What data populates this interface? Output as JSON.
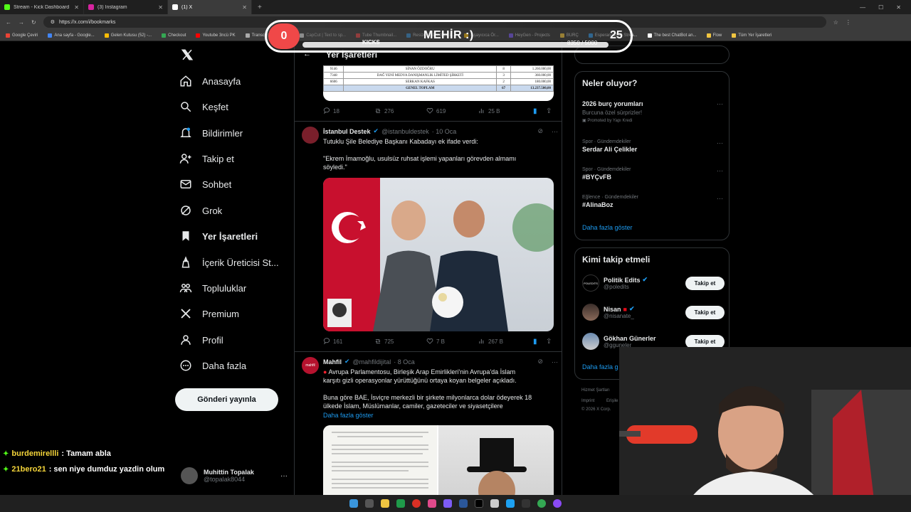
{
  "browser": {
    "tabs": [
      {
        "title": "Stream - Kick Dashboard",
        "color": "#53fc18",
        "active": false
      },
      {
        "title": "(3) Instagram",
        "color": "#d6249f",
        "active": false
      },
      {
        "title": "(1) X",
        "color": "#ffffff",
        "active": true
      }
    ],
    "url": "https://x.com/i/bookmarks",
    "bookmarks": [
      "Google Çeviri",
      "Ana sayfa - Google...",
      "Gelen Kutusu (52) -...",
      "Checkout",
      "Youtube 3ncü PK",
      "Transcript of \"M M...",
      "CapCut | Text to sp...",
      "Tube Thumbnail...",
      "Resize and reduce i...",
      "İşşayıcıca Ör...",
      "HeyGen - Projects",
      "BURÇ",
      "Esperanza000 Strea...",
      "The best ChatBot an...",
      "Flow",
      "Tüm Yer İşaretleri"
    ]
  },
  "overlay": {
    "left_count": "0",
    "title": "MEHİR :)",
    "label": "KICKS",
    "progress_text": "8350 / 5000",
    "progress_fraction": 1.0,
    "right_count": "25"
  },
  "nav": {
    "items": [
      {
        "label": "Anasayfa",
        "icon": "home-icon"
      },
      {
        "label": "Keşfet",
        "icon": "search-icon"
      },
      {
        "label": "Bildirimler",
        "icon": "bell-icon"
      },
      {
        "label": "Takip et",
        "icon": "add-user-icon"
      },
      {
        "label": "Sohbet",
        "icon": "mail-icon"
      },
      {
        "label": "Grok",
        "icon": "grok-icon"
      },
      {
        "label": "Yer İşaretleri",
        "icon": "bookmark-icon"
      },
      {
        "label": "İçerik Üreticisi St...",
        "icon": "creator-icon"
      },
      {
        "label": "Topluluklar",
        "icon": "communities-icon"
      },
      {
        "label": "Premium",
        "icon": "x-logo-icon"
      },
      {
        "label": "Profil",
        "icon": "profile-icon"
      },
      {
        "label": "Daha fazla",
        "icon": "more-icon"
      }
    ],
    "post_button": "Gönderi yayınla",
    "profile": {
      "name": "Muhittin Topalak",
      "handle": "@topalak8044"
    }
  },
  "chat": [
    {
      "user": "burdemirellli",
      "message": ": Tamam abla"
    },
    {
      "user": "21bero21",
      "message": ": sen niye dumduz yazdin olum"
    }
  ],
  "timeline": {
    "header_title": "Yer İşaretleri",
    "table_rows": [
      {
        "no": "9146",
        "name": "SİNAN ÖZDOĞRU",
        "qty": "8",
        "amount": "1.260.000,00"
      },
      {
        "no": "7348",
        "name": "DAĞ YENİ MEDYA DANIŞMANLIK LİMİTED ŞİRKETİ",
        "qty": "3",
        "amount": "360.000,00"
      },
      {
        "no": "6606",
        "name": "SERKAN KAFKAS",
        "qty": "2",
        "amount": "180.000,00"
      }
    ],
    "table_total": {
      "label": "GENEL TOPLAM",
      "qty": "67",
      "amount": "13.237.500,00"
    },
    "first_actions": {
      "replies": "18",
      "reposts": "276",
      "likes": "619",
      "views": "25 B"
    },
    "tweets": [
      {
        "name": "İstanbul Destek",
        "handle": "@istanbuldestek",
        "date": "· 10 Oca",
        "lines": [
          "Tutuklu Şile Belediye Başkanı Kabadayı ek ifade verdi:",
          "",
          "\"Ekrem İmamoğlu, usulsüz ruhsat işlemi yapanları görevden almamı",
          "söyledi.\""
        ],
        "actions": {
          "replies": "161",
          "reposts": "725",
          "likes": "7 B",
          "views": "267 B"
        }
      },
      {
        "name": "Mahfil",
        "handle": "@mahfildijital",
        "date": "· 8 Oca",
        "lines": [
          "Avrupa Parlamentosu, Birleşik Arap Emirlikleri'nin Avrupa'da İslam",
          "karşıtı gizli operasyonlar yürüttüğünü ortaya koyan belgeler açıkladı.",
          "",
          "Buna göre BAE, İsviçre merkezli bir şirkete milyonlarca dolar ödeyerek 18",
          "ülkede İslam, Müslümanlar, camiler, gazeteciler ve siyasetçilere"
        ],
        "more": "Daha fazla göster"
      }
    ]
  },
  "right": {
    "trends_title": "Neler oluyor?",
    "trends": [
      {
        "category": "",
        "title": "2026 burç yorumları",
        "sub": "Burcuna özel sürprizler!",
        "promo": "Promoted by Yapı Kredi"
      },
      {
        "category": "Spor · Gündemdekiler",
        "title": "Serdar Ali Çelikler"
      },
      {
        "category": "Spor · Gündemdekiler",
        "title": "#BYÇvFB"
      },
      {
        "category": "Eğlence · Gündemdekiler",
        "title": "#AlinaBoz"
      }
    ],
    "show_more": "Daha fazla göster",
    "who_title": "Kimi takip etmeli",
    "who": [
      {
        "name": "Politik Edits",
        "handle": "@poledits",
        "button": "Takip et"
      },
      {
        "name": "Nisan",
        "handle": "@nisanate_",
        "button": "Takip et"
      },
      {
        "name": "Gökhan Günerler",
        "handle": "@gguneler",
        "button": "Takip et"
      }
    ],
    "who_more": "Daha fazla g",
    "footer": [
      "Hizmet Şartları",
      "Imprint",
      "Erişile",
      "© 2026 X Corp."
    ]
  },
  "colors": {
    "accent": "#1d9bf0",
    "kick": "#53fc18",
    "overlay_red": "#f04848"
  }
}
